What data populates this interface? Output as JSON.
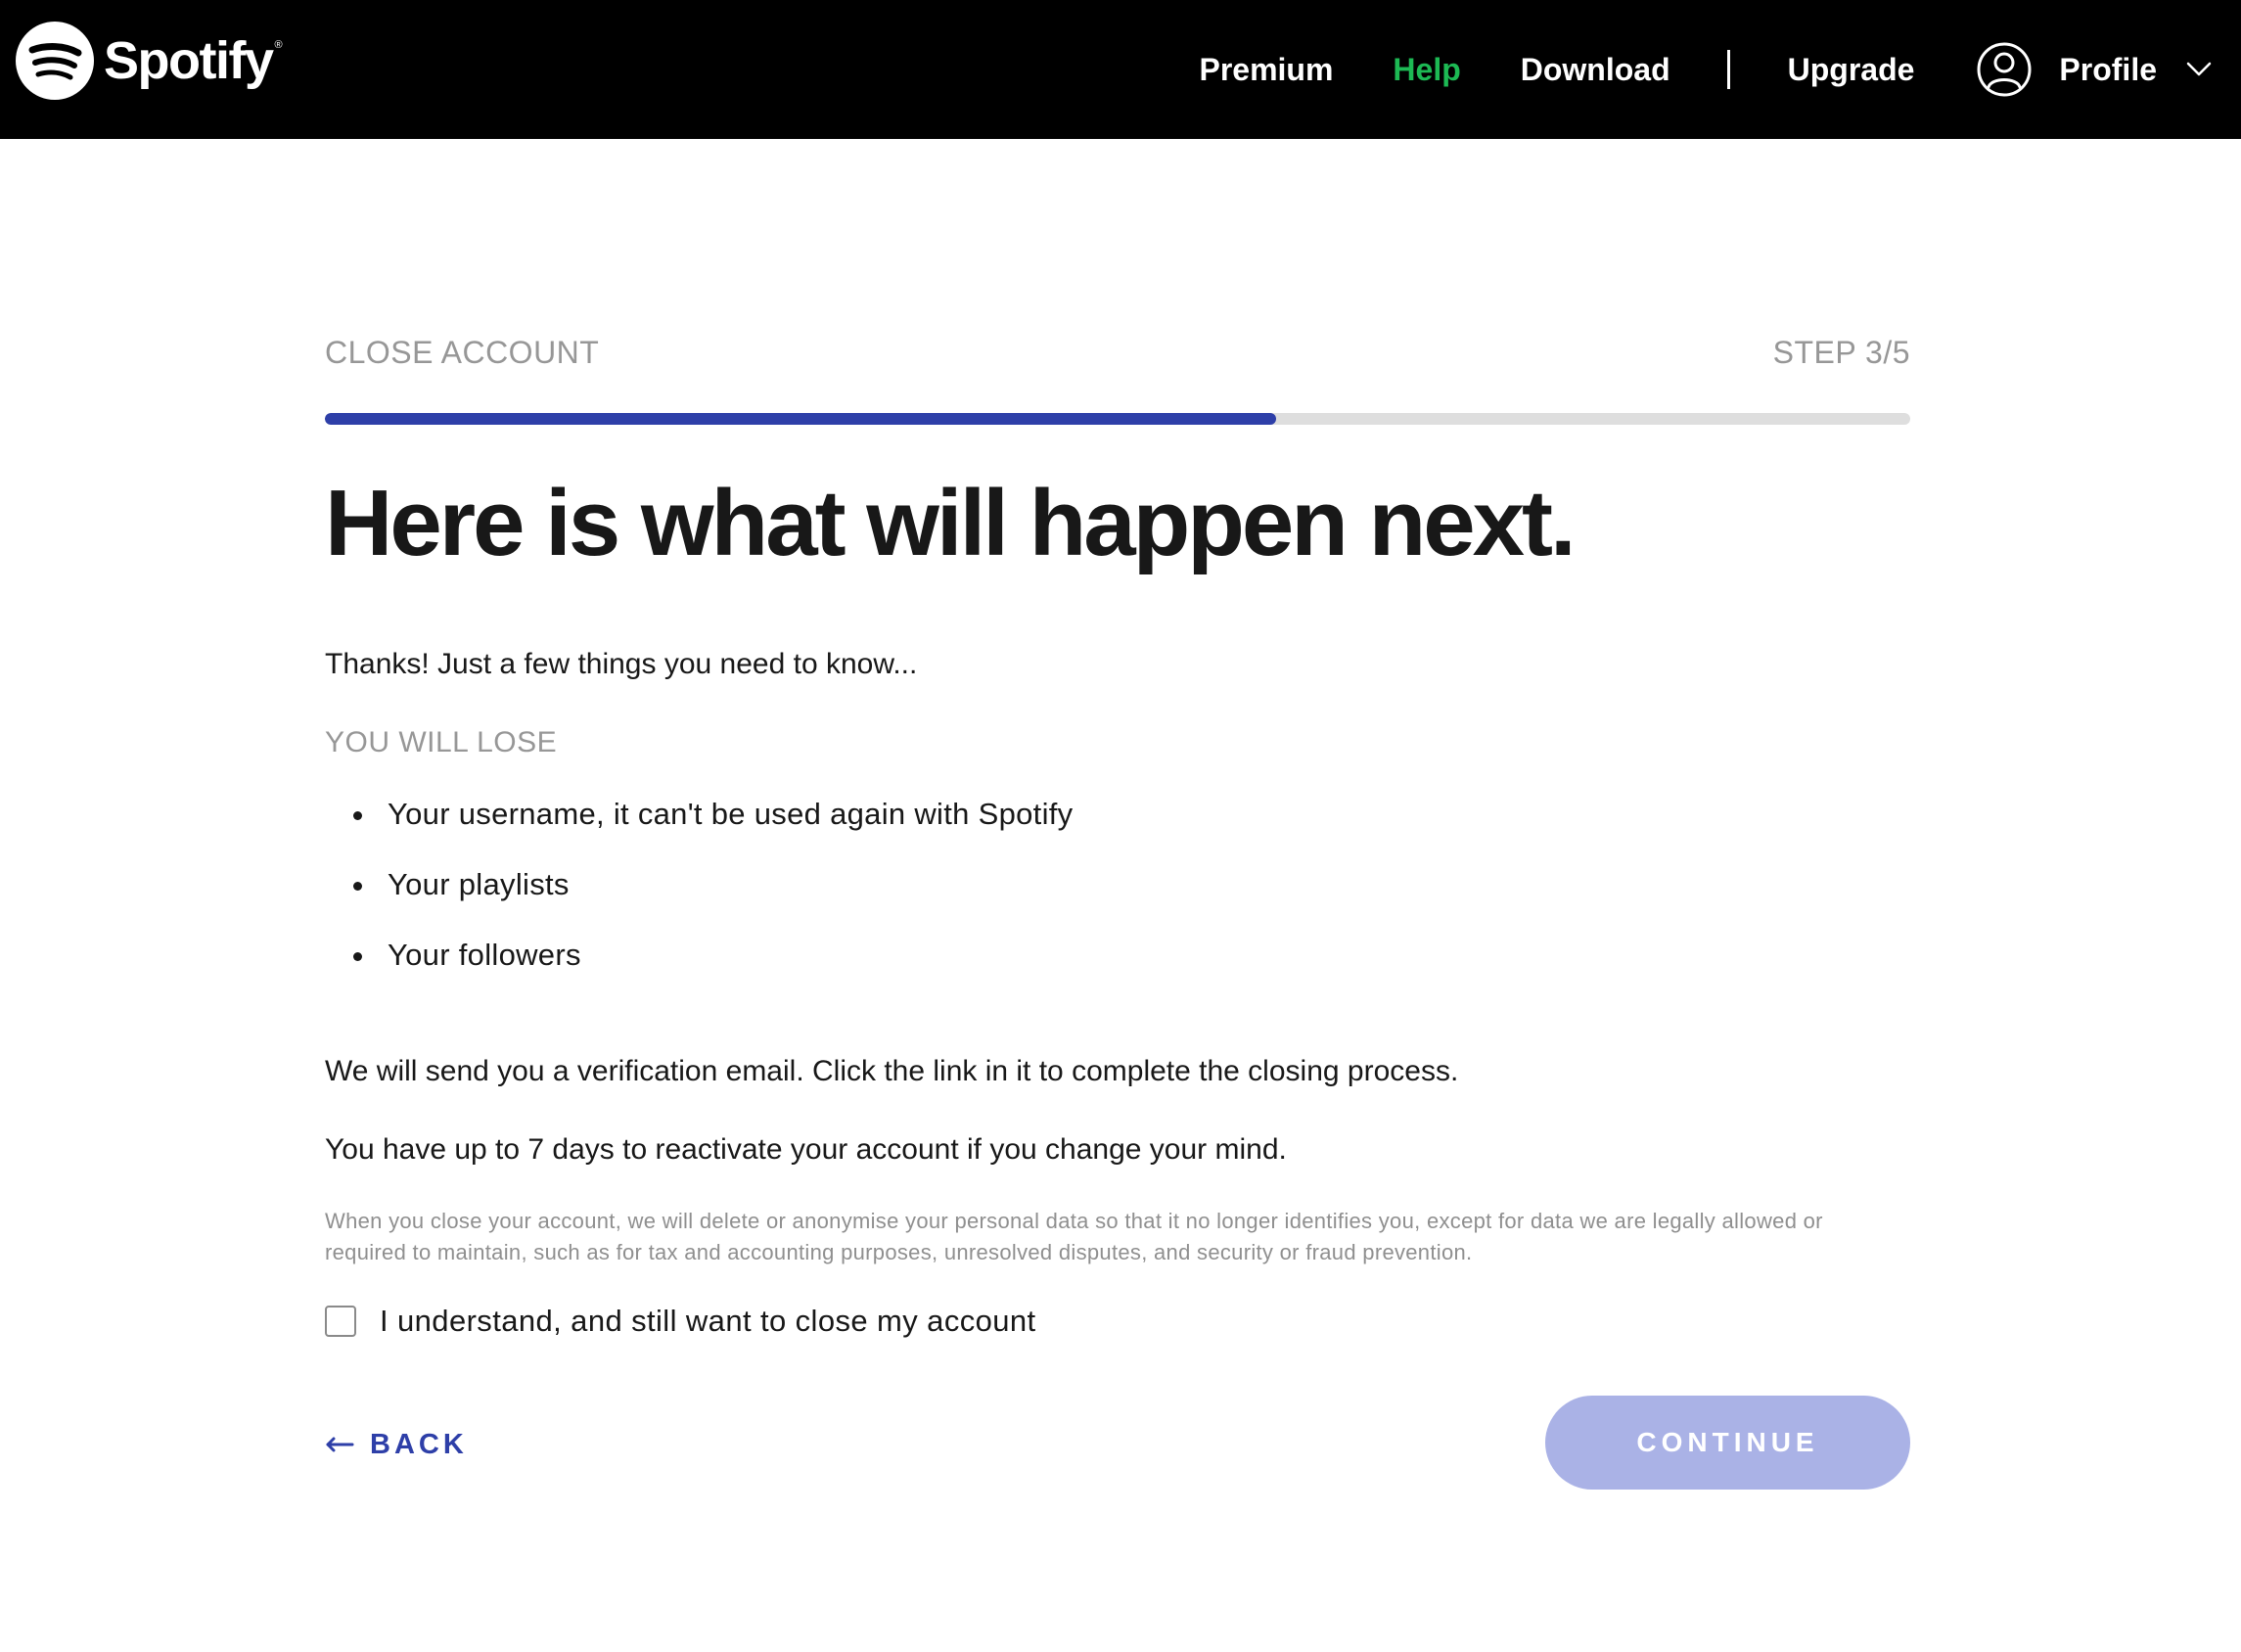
{
  "brand": {
    "name": "Spotify",
    "registered_mark": "®",
    "logo_icon": "spotify-logo-icon",
    "accent_color": "#1db954",
    "primary_color": "#2e3fa8"
  },
  "nav": {
    "premium": "Premium",
    "help": "Help",
    "download": "Download",
    "upgrade": "Upgrade",
    "profile": "Profile",
    "active_item": "Help",
    "profile_icon": "user-circle-icon",
    "chevron_icon": "chevron-down-icon"
  },
  "flow": {
    "section_label": "CLOSE ACCOUNT",
    "step_label": "STEP 3/5",
    "progress": 0.6
  },
  "content": {
    "headline": "Here is what will happen next.",
    "intro": "Thanks! Just a few things you need to know...",
    "lose_label": "YOU WILL LOSE",
    "lose_items": [
      "Your username, it can't be used again with Spotify",
      "Your playlists",
      "Your followers"
    ],
    "verification_text": "We will send you a verification email. Click the link in it to complete the closing process.",
    "reactivate_text": "You have up to 7 days to reactivate your account if you change your mind.",
    "legal_text": "When you close your account, we will delete or anonymise your personal data so that it no longer identifies you, except for data we are legally allowed or required to maintain, such as for tax and accounting purposes, unresolved disputes, and security or fraud prevention."
  },
  "confirm": {
    "label": "I understand, and still want to close my account",
    "checked": false
  },
  "actions": {
    "back_label": "BACK",
    "back_icon": "arrow-left-icon",
    "continue_label": "CONTINUE",
    "continue_disabled": true
  }
}
